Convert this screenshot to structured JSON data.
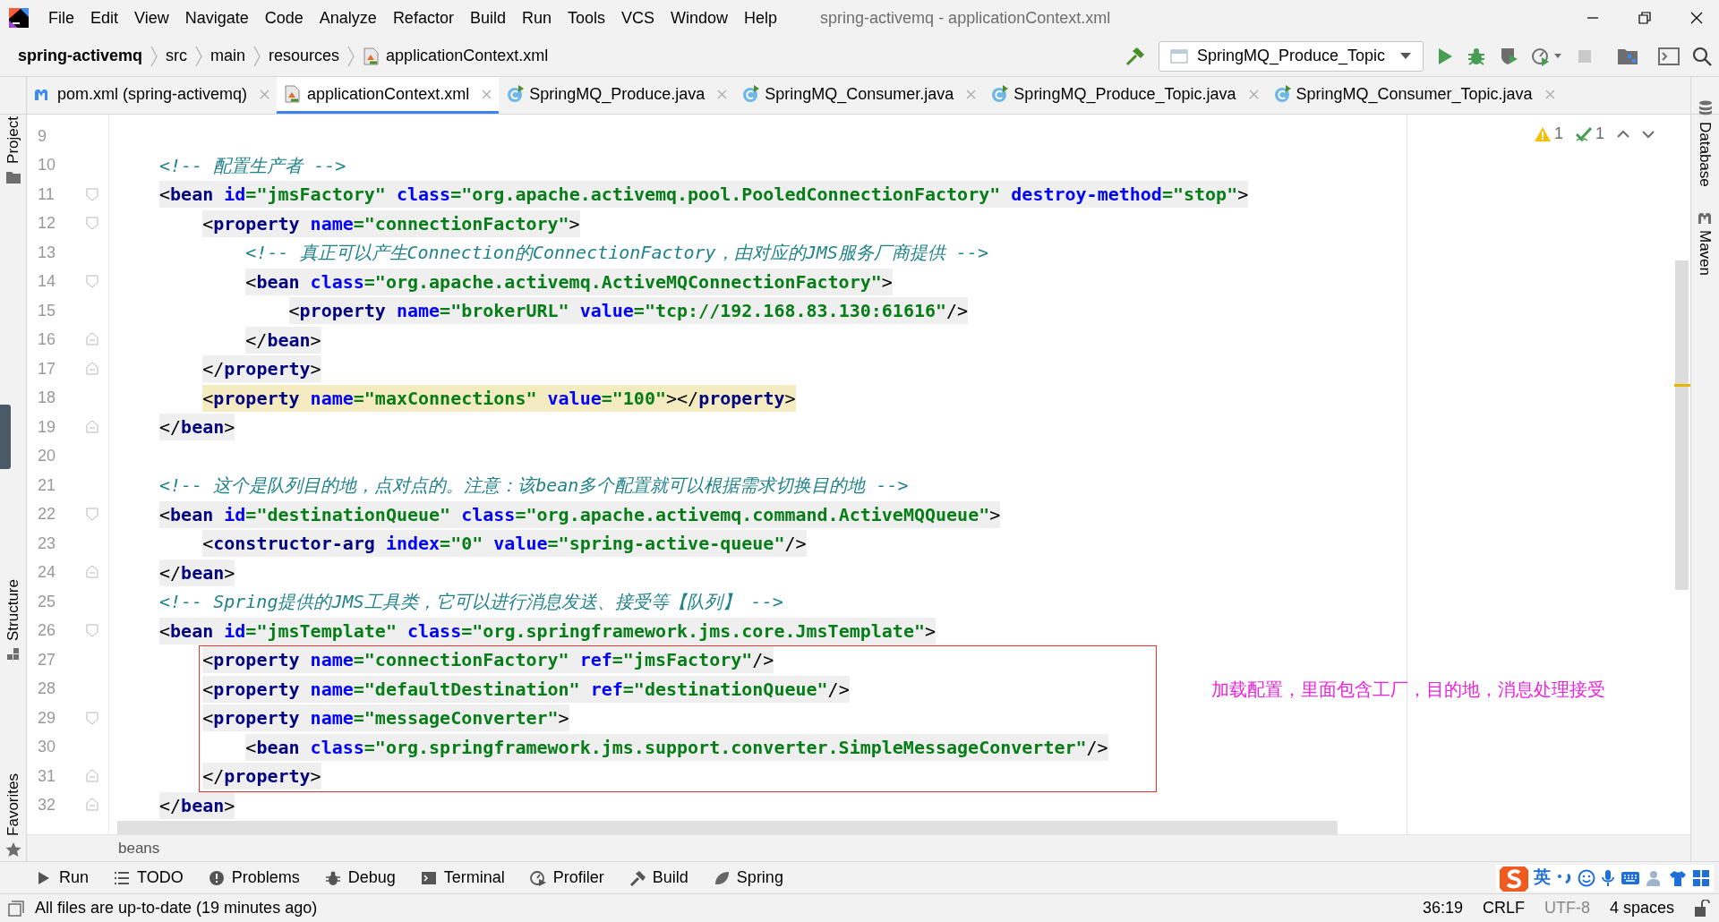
{
  "window": {
    "title": "spring-activemq - applicationContext.xml"
  },
  "menu": [
    "File",
    "Edit",
    "View",
    "Navigate",
    "Code",
    "Analyze",
    "Refactor",
    "Build",
    "Run",
    "Tools",
    "VCS",
    "Window",
    "Help"
  ],
  "breadcrumbs": [
    "spring-activemq",
    "src",
    "main",
    "resources",
    "applicationContext.xml"
  ],
  "run_config": "SpringMQ_Produce_Topic",
  "tabs": [
    {
      "label": "pom.xml (spring-activemq)",
      "kind": "maven",
      "selected": false
    },
    {
      "label": "applicationContext.xml",
      "kind": "xml",
      "selected": true
    },
    {
      "label": "SpringMQ_Produce.java",
      "kind": "class",
      "selected": false
    },
    {
      "label": "SpringMQ_Consumer.java",
      "kind": "class",
      "selected": false
    },
    {
      "label": "SpringMQ_Produce_Topic.java",
      "kind": "class",
      "selected": false
    },
    {
      "label": "SpringMQ_Consumer_Topic.java",
      "kind": "class",
      "selected": false
    }
  ],
  "left_tools": [
    "Project",
    "Structure",
    "Favorites"
  ],
  "right_tools": [
    "Database",
    "Maven"
  ],
  "inspections": {
    "warnings": "1",
    "typos": "1"
  },
  "editor": {
    "lines": [
      {
        "number": "9"
      },
      {
        "number": "10",
        "text": "<!-- 配置生产者 -->"
      },
      {
        "number": "11",
        "text": "<bean id=\"jmsFactory\" class=\"org.apache.activemq.pool.PooledConnectionFactory\" destroy-method=\"stop\">",
        "kind": "fold_open"
      },
      {
        "number": "12",
        "text": "    <property name=\"connectionFactory\">",
        "kind": "fold_open"
      },
      {
        "number": "13",
        "text": "        <!-- 真正可以产生Connection的ConnectionFactory，由对应的JMS服务厂商提供 -->"
      },
      {
        "number": "14",
        "text": "        <bean class=\"org.apache.activemq.ActiveMQConnectionFactory\">",
        "kind": "fold_open"
      },
      {
        "number": "15",
        "text": "            <property name=\"brokerURL\" value=\"tcp://192.168.83.130:61616\"/>"
      },
      {
        "number": "16",
        "text": "        </bean>",
        "kind": "fold_close"
      },
      {
        "number": "17",
        "text": "    </property>",
        "kind": "fold_close"
      },
      {
        "number": "18",
        "text": "    <property name=\"maxConnections\" value=\"100\"></property>",
        "warning": true
      },
      {
        "number": "19",
        "text": "</bean>",
        "kind": "fold_close"
      },
      {
        "number": "20"
      },
      {
        "number": "21",
        "text": "<!-- 这个是队列目的地，点对点的。注意：该bean多个配置就可以根据需求切换目的地 -->"
      },
      {
        "number": "22",
        "text": "<bean id=\"destinationQueue\" class=\"org.apache.activemq.command.ActiveMQQueue\">",
        "kind": "fold_open"
      },
      {
        "number": "23",
        "text": "    <constructor-arg index=\"0\" value=\"spring-active-queue\"/>"
      },
      {
        "number": "24",
        "text": "</bean>",
        "kind": "fold_close"
      },
      {
        "number": "25",
        "text": "<!-- Spring提供的JMS工具类，它可以进行消息发送、接受等【队列】 -->"
      },
      {
        "number": "26",
        "text": "<bean id=\"jmsTemplate\" class=\"org.springframework.jms.core.JmsTemplate\">",
        "kind": "fold_open"
      },
      {
        "number": "27",
        "text": "    <property name=\"connectionFactory\" ref=\"jmsFactory\"/>"
      },
      {
        "number": "28",
        "text": "    <property name=\"defaultDestination\" ref=\"destinationQueue\"/>"
      },
      {
        "number": "29",
        "text": "    <property name=\"messageConverter\">",
        "kind": "fold_open"
      },
      {
        "number": "30",
        "text": "        <bean class=\"org.springframework.jms.support.converter.SimpleMessageConverter\"/>"
      },
      {
        "number": "31",
        "text": "    </property>",
        "kind": "fold_close"
      },
      {
        "number": "32",
        "text": "</bean>",
        "kind": "fold_close"
      }
    ],
    "path": "beans"
  },
  "annotation": "加载配置，里面包含工厂，目的地，消息处理接受",
  "tool_windows": [
    {
      "label": "Run",
      "kind": "run"
    },
    {
      "label": "TODO",
      "kind": "todo"
    },
    {
      "label": "Problems",
      "kind": "problems"
    },
    {
      "label": "Debug",
      "kind": "debug"
    },
    {
      "label": "Terminal",
      "kind": "terminal"
    },
    {
      "label": "Profiler",
      "kind": "profiler"
    },
    {
      "label": "Build",
      "kind": "build"
    },
    {
      "label": "Spring",
      "kind": "spring"
    }
  ],
  "ime": {
    "mode": "英"
  },
  "status_bar": {
    "message": "All files are up-to-date (19 minutes ago)",
    "position": "36:19",
    "line_separator": "CRLF",
    "encoding": "UTF-8",
    "indent": "4 spaces"
  }
}
